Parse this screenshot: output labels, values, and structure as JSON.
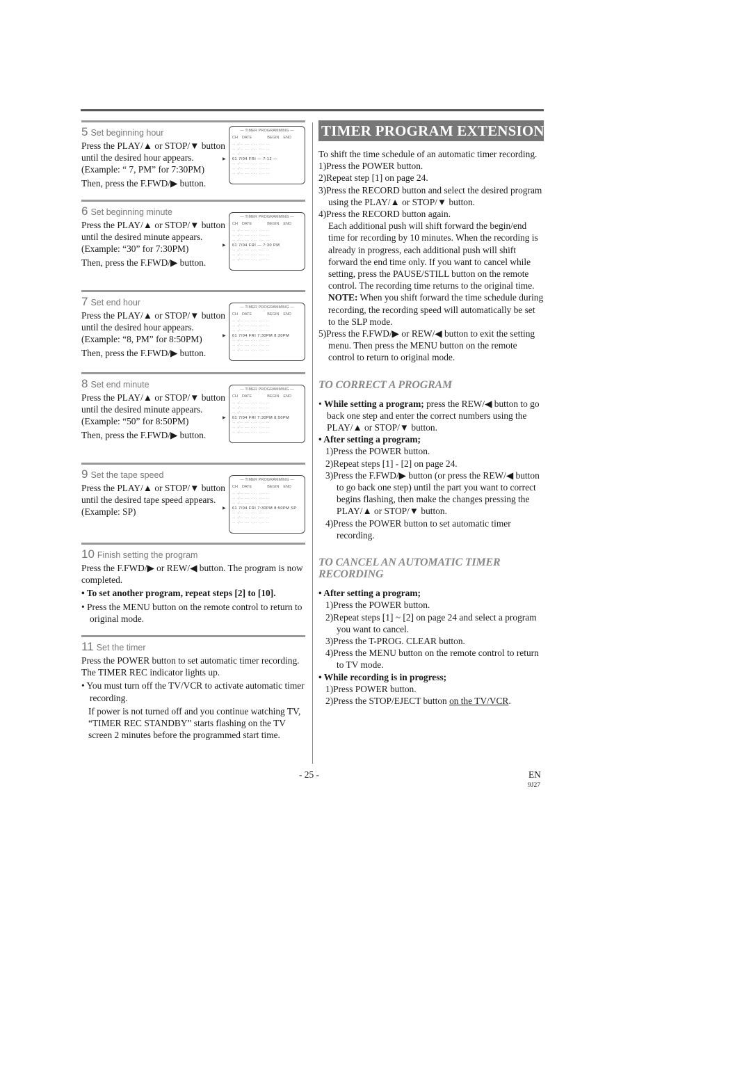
{
  "page": {
    "page_number": "- 25 -",
    "language": "EN",
    "code": "9J27"
  },
  "left": {
    "steps": [
      {
        "num": "5",
        "title": "Set beginning hour",
        "lines": [
          "Press the PLAY/▲ or STOP/▼ button until the desired hour appears. (Example: “ 7, PM” for 7:30PM)",
          "Then, press the F.FWD/▶ button."
        ],
        "osd": {
          "title": "— TIMER PROGRAMMING —",
          "headers": [
            "CH",
            "DATE",
            "BEGIN",
            "END"
          ],
          "row": "61  7/04  FRI — 7:12 —",
          "flash": "hour"
        }
      },
      {
        "num": "6",
        "title": "Set beginning minute",
        "lines": [
          "Press the PLAY/▲ or STOP/▼ button until the desired minute appears.  (Example: “30” for 7:30PM)",
          "Then, press the F.FWD/▶ button."
        ],
        "osd": {
          "title": "— TIMER PROGRAMMING —",
          "headers": [
            "CH",
            "DATE",
            "BEGIN",
            "END"
          ],
          "row": "61  7/04  FRI — 7:30 PM",
          "flash": "minute"
        }
      },
      {
        "num": "7",
        "title": "Set end hour",
        "lines": [
          "Press the PLAY/▲ or STOP/▼ button until the desired hour appears. (Example: “8, PM” for 8:50PM)",
          "Then, press the F.FWD/▶ button."
        ],
        "osd": {
          "title": "— TIMER PROGRAMMING —",
          "headers": [
            "CH",
            "DATE",
            "BEGIN",
            "END"
          ],
          "row": "61  7/04  FRI  7:30PM  8:30PM",
          "flash": "end-hour"
        }
      },
      {
        "num": "8",
        "title": "Set end minute",
        "lines": [
          "Press the PLAY/▲ or STOP/▼ button until the desired minute appears.  (Example: “50” for 8:50PM)",
          "Then, press the F.FWD/▶ button."
        ],
        "osd": {
          "title": "— TIMER PROGRAMMING —",
          "headers": [
            "CH",
            "DATE",
            "BEGIN",
            "END"
          ],
          "row": "61  7/04  FRI  7:30PM  8:50PM",
          "flash": "end-minute"
        }
      },
      {
        "num": "9",
        "title": "Set the tape speed",
        "lines": [
          "Press the PLAY/▲ or STOP/▼ button until the desired tape speed appears. (Example: SP)"
        ],
        "osd": {
          "title": "— TIMER PROGRAMMING —",
          "headers": [
            "CH",
            "DATE",
            "BEGIN",
            "END"
          ],
          "row": "61  7/04  FRI  7:30PM  8:50PM  SP",
          "flash": "speed"
        }
      }
    ],
    "step10": {
      "num": "10",
      "title": "Finish setting the program",
      "text": "Press the F.FWD/▶ or REW/◀ button. The program is now completed.",
      "bullet1": "To set another program, repeat steps [2] to [10].",
      "bullet2": "Press the MENU button on the remote control to return to original mode."
    },
    "step11": {
      "num": "11",
      "title": "Set the timer",
      "text": "Press the POWER button to set automatic timer recording. The TIMER REC indicator lights up.",
      "bullet1": "You must turn off the TV/VCR to activate automatic timer recording.",
      "bullet1_cont": "If power is not turned off and you continue watching TV, “TIMER REC STANDBY” starts flashing on the TV screen 2 minutes before the programmed start time."
    }
  },
  "right": {
    "banner": "TIMER PROGRAM EXTENSION",
    "intro": "To shift the time schedule of an automatic timer recording.",
    "ext_steps": [
      "1)Press the POWER button.",
      "2)Repeat step [1] on page 24.",
      "3)Press the RECORD button and select the desired program using the PLAY/▲ or STOP/▼ button.",
      "4)Press the RECORD button again."
    ],
    "ext_para": "Each additional push will shift forward the begin/end time for recording by 10 minutes. When the recording is already in progress, each additional push will shift forward the end time only. If you want to cancel while setting, press the PAUSE/STILL button on the remote control. The recording time returns to the original time.",
    "note_label": "NOTE:",
    "note_text": " When you shift forward the time schedule during recording, the recording speed will automatically be set to the SLP mode.",
    "ext_step5": "5)Press the F.FWD/▶ or REW/◀ button to exit the setting menu. Then press the MENU button on the remote control to return to original mode.",
    "correct": {
      "heading": "TO CORRECT A PROGRAM",
      "while_label": "While setting a program;",
      "while_text": " press the REW/◀ button to go back one step and enter the correct numbers using the PLAY/▲ or STOP/▼ button.",
      "after_label": "After setting a program;",
      "after_steps": [
        "1)Press the POWER button.",
        "2)Repeat steps [1] - [2] on page 24.",
        "3)Press the F.FWD/▶ button (or press the REW/◀ button to go back one step) until the part you want to correct begins flashing, then make the changes pressing the PLAY/▲ or STOP/▼ button.",
        "4)Press the POWER button to set automatic timer recording."
      ]
    },
    "cancel": {
      "heading": "TO CANCEL AN AUTOMATIC TIMER RECORDING",
      "after_label": "After setting a program;",
      "after_steps": [
        "1)Press the POWER button.",
        "2)Repeat steps [1] ~ [2] on page 24 and select a program you want to cancel.",
        "3)Press the T-PROG. CLEAR button.",
        "4)Press the MENU button on the remote control to return to TV mode."
      ],
      "during_label": "While recording is in progress;",
      "during_step1": "1)Press POWER button.",
      "during_step2_pre": "2)Press the STOP/EJECT button ",
      "during_step2_u": "on the TV/VCR",
      "during_step2_post": "."
    }
  }
}
